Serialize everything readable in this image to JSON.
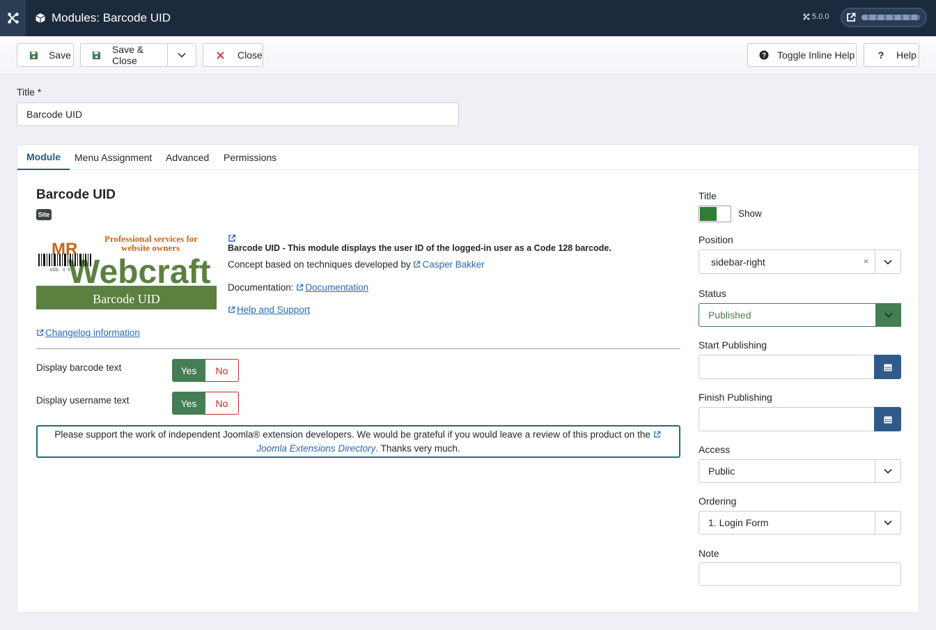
{
  "header": {
    "title": "Modules: Barcode UID",
    "version": "5.0.0"
  },
  "toolbar": {
    "save": "Save",
    "save_close": "Save & Close",
    "close": "Close",
    "toggle_help": "Toggle Inline Help",
    "help": "Help"
  },
  "title_field": {
    "label": "Title *",
    "value": "Barcode UID"
  },
  "tabs": [
    "Module",
    "Menu Assignment",
    "Advanced",
    "Permissions"
  ],
  "module": {
    "heading": "Barcode UID",
    "badge": "Site",
    "logo": {
      "mr": "MR",
      "tagline1": "Professional services for",
      "tagline2": "website owners",
      "brand": "Webcraft",
      "barcode_digits": "UID: 1 5",
      "banner": "Barcode UID"
    },
    "description": "Barcode UID - This module displays the user ID of the logged-in user as a Code 128 barcode.",
    "concept_prefix": "Concept based on techniques developed by",
    "concept_link": "Casper Bakker",
    "doc_prefix": "Documentation:",
    "doc_link": "Documentation",
    "support_link": "Help and Support",
    "changelog_link": "Changelog information",
    "options": [
      {
        "label": "Display barcode text",
        "yes": "Yes",
        "no": "No"
      },
      {
        "label": "Display username text",
        "yes": "Yes",
        "no": "No"
      }
    ],
    "notice_text": "Please support the work of independent Joomla® extension developers. We would be grateful if you would leave a review of this product on the",
    "notice_link": "Joomla Extensions Directory",
    "notice_end": ". Thanks very much."
  },
  "sidebar": {
    "title_label": "Title",
    "title_show": "Show",
    "position_label": "Position",
    "position_value": "sidebar-right",
    "status_label": "Status",
    "status_value": "Published",
    "start_label": "Start Publishing",
    "start_value": "",
    "finish_label": "Finish Publishing",
    "finish_value": "",
    "access_label": "Access",
    "access_value": "Public",
    "ordering_label": "Ordering",
    "ordering_value": "1. Login Form",
    "note_label": "Note",
    "note_value": ""
  },
  "colors": {
    "header_bg": "#1b2a3c",
    "accent_green": "#457d54",
    "danger_red": "#c52827",
    "link_blue": "#2a69b8",
    "calendar_blue": "#2f5a8a"
  }
}
